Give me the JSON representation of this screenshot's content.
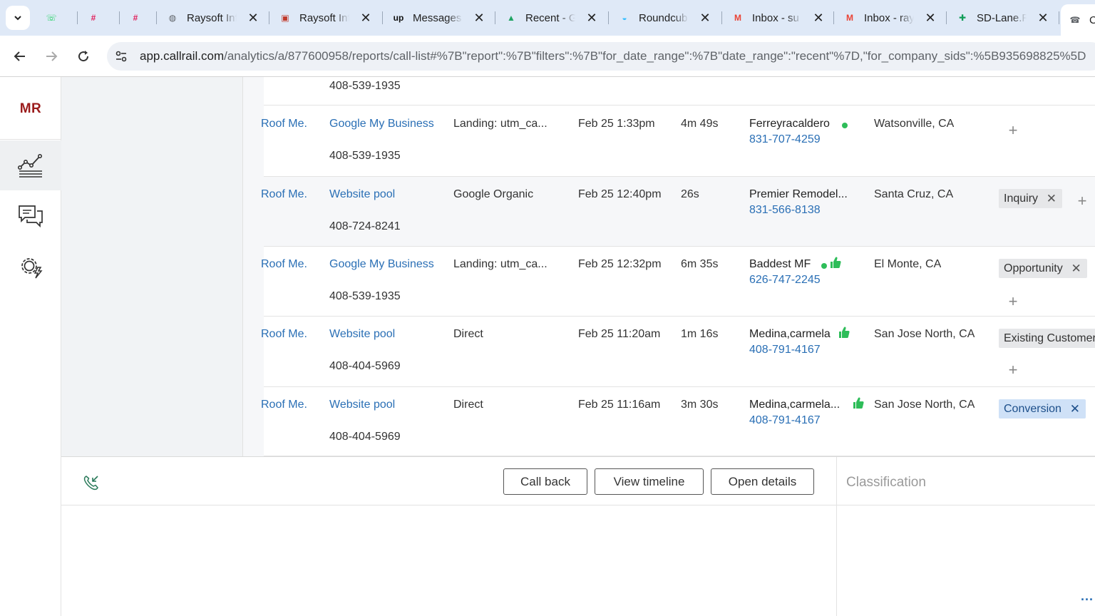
{
  "browser": {
    "tabs": [
      {
        "title": "",
        "icon": "whatsapp-icon",
        "color": "#25D366",
        "glyph": "☏"
      },
      {
        "title": "",
        "icon": "slack-icon",
        "color": "#E01E5A",
        "glyph": "#"
      },
      {
        "title": "",
        "icon": "slack-icon",
        "color": "#E01E5A",
        "glyph": "#"
      },
      {
        "title": "Raysoft Inf",
        "icon": "globe-icon",
        "color": "#5f6368",
        "glyph": "◍"
      },
      {
        "title": "Raysoft Inf",
        "icon": "raysoft-icon",
        "color": "#c0392b",
        "glyph": "▣"
      },
      {
        "title": "Messages",
        "icon": "upwork-icon",
        "color": "#111111",
        "glyph": "up"
      },
      {
        "title": "Recent - G",
        "icon": "google-drive-icon",
        "color": "#1FA463",
        "glyph": "▲"
      },
      {
        "title": "Roundcub",
        "icon": "roundcube-icon",
        "color": "#37beff",
        "glyph": "◒"
      },
      {
        "title": "Inbox - su",
        "icon": "gmail-icon",
        "color": "#EA4335",
        "glyph": "M"
      },
      {
        "title": "Inbox - ray",
        "icon": "gmail-icon",
        "color": "#EA4335",
        "glyph": "M"
      },
      {
        "title": "SD-Lane.R",
        "icon": "google-sheets-icon",
        "color": "#0F9D58",
        "glyph": "✚"
      },
      {
        "title": "C",
        "icon": "callrail-icon",
        "color": "#5f6368",
        "glyph": "☎"
      }
    ],
    "url_host": "app.callrail.com",
    "url_path": "/analytics/a/877600958/reports/call-list#%7B\"report\":%7B\"filters\":%7B\"for_date_range\":%7B\"date_range\":\"recent\"%7D,\"for_company_sids\":%5B935698825%5D"
  },
  "app": {
    "user_initials": "MR"
  },
  "top_partial_row": {
    "tracking_number": "408-539-1935"
  },
  "calls": [
    {
      "account": "Roof Me...",
      "source": "Google My Business",
      "tracking_number": "408-539-1935",
      "landing": "Landing: utm_ca...",
      "time": "Feb 25 1:33pm",
      "duration": "4m 49s",
      "caller": "Ferreyracaldero",
      "caller_phone": "831-707-4259",
      "location": "Watsonville, CA",
      "tag": "",
      "has_dot": true,
      "has_thumb": false
    },
    {
      "account": "Roof Me...",
      "source": "Website pool",
      "tracking_number": "408-724-8241",
      "landing": "Google Organic",
      "time": "Feb 25 12:40pm",
      "duration": "26s",
      "caller": "Premier Remodel...",
      "caller_phone": "831-566-8138",
      "location": "Santa Cruz, CA",
      "tag": "Inquiry",
      "has_dot": false,
      "has_thumb": false
    },
    {
      "account": "Roof Me...",
      "source": "Google My Business",
      "tracking_number": "408-539-1935",
      "landing": "Landing: utm_ca...",
      "time": "Feb 25 12:32pm",
      "duration": "6m 35s",
      "caller": "Baddest MF",
      "caller_phone": "626-747-2245",
      "location": "El Monte, CA",
      "tag": "Opportunity",
      "has_dot": true,
      "has_thumb": true
    },
    {
      "account": "Roof Me...",
      "source": "Website pool",
      "tracking_number": "408-404-5969",
      "landing": "Direct",
      "time": "Feb 25 11:20am",
      "duration": "1m 16s",
      "caller": "Medina,carmela",
      "caller_phone": "408-791-4167",
      "location": "San Jose North, CA",
      "tag": "Existing Customer",
      "has_dot": false,
      "has_thumb": true
    },
    {
      "account": "Roof Me...",
      "source": "Website pool",
      "tracking_number": "408-404-5969",
      "landing": "Direct",
      "time": "Feb 25 11:16am",
      "duration": "3m 30s",
      "caller": "Medina,carmela...",
      "caller_phone": "408-791-4167",
      "location": "San Jose North, CA",
      "tag": "Conversion",
      "has_dot": false,
      "has_thumb": true
    }
  ],
  "actions": {
    "call_back": "Call back",
    "view_timeline": "View timeline",
    "open_details": "Open details"
  },
  "side_panel": {
    "title": "Classification",
    "more": "..."
  },
  "colors": {
    "link": "#2a6fb5",
    "initials": "#9b1c1c",
    "online_dot": "#2ebd59",
    "thumb_up": "#2ebd59",
    "conversion_tag": "#cfe1f7"
  }
}
